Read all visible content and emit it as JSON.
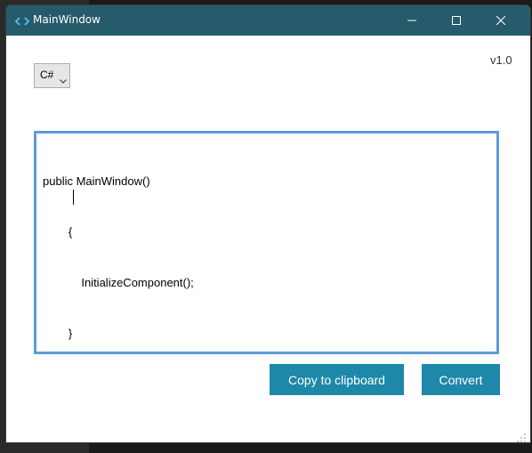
{
  "window": {
    "title": "MainWindow",
    "icon": "code-brackets-icon",
    "accent_color": "#265b6c"
  },
  "toolbar": {
    "language_selected": "C#",
    "version": "v1.0"
  },
  "editor": {
    "lines": [
      "public MainWindow()",
      "        {",
      "            InitializeComponent();",
      "        }"
    ],
    "border_color": "#5e9bd9"
  },
  "actions": {
    "copy_label": "Copy to clipboard",
    "convert_label": "Convert",
    "button_color": "#1e88a8"
  }
}
